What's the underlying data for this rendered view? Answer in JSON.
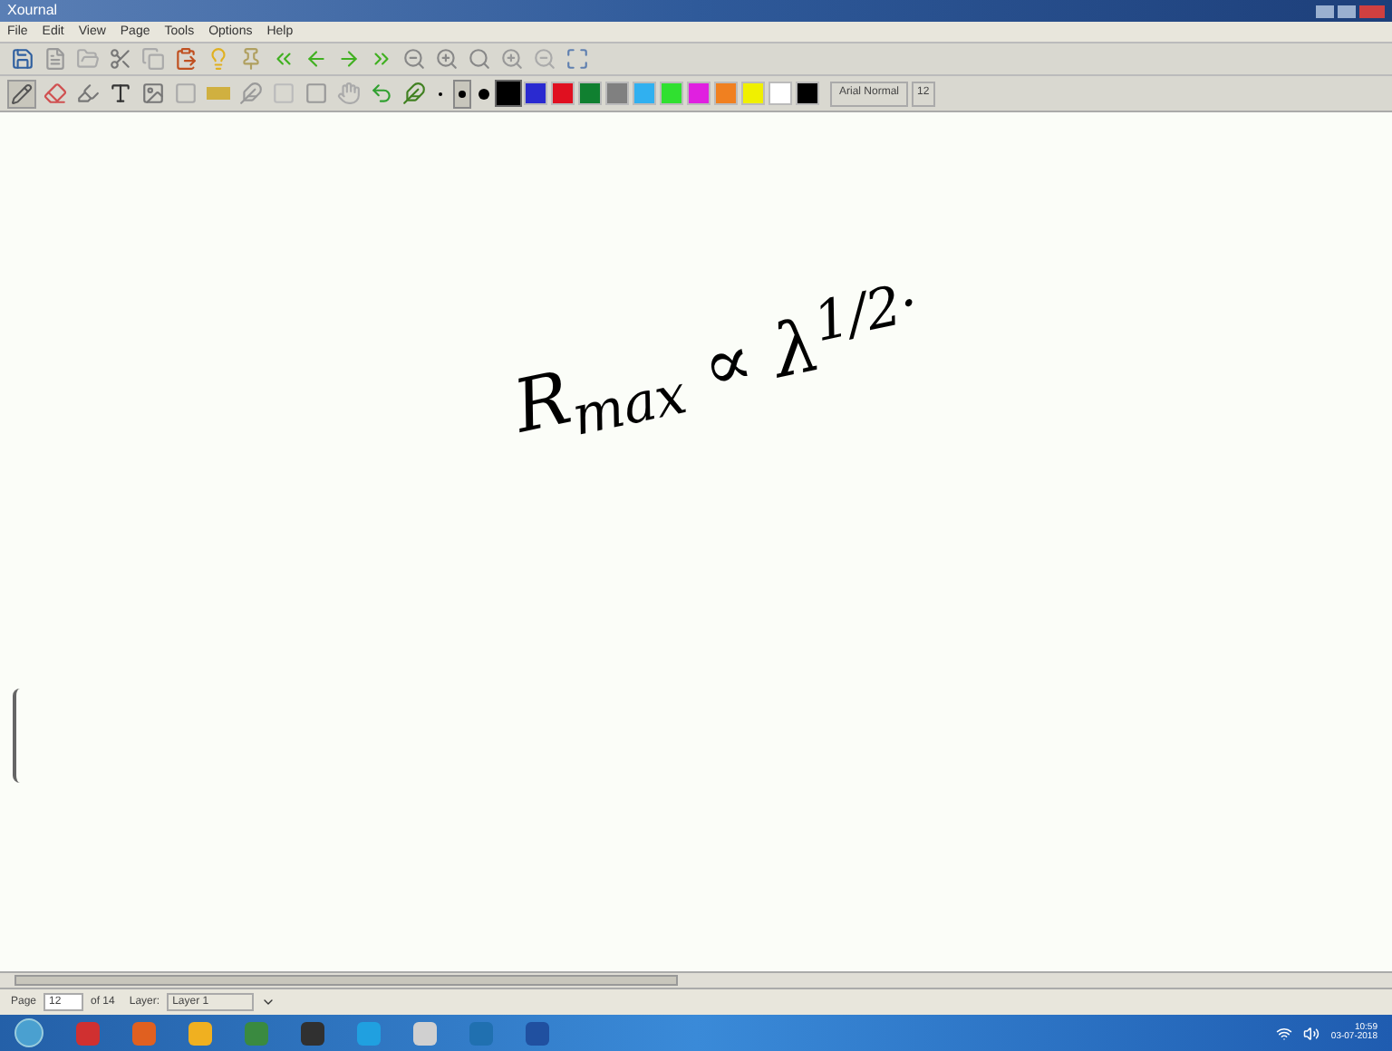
{
  "window": {
    "title": "Xournal"
  },
  "menu": [
    "File",
    "Edit",
    "View",
    "Page",
    "Tools",
    "Options",
    "Help"
  ],
  "pen_widths": [
    {
      "selected": false
    },
    {
      "selected": true
    },
    {
      "selected": false
    }
  ],
  "colors": [
    {
      "color": "#000000",
      "selected": true
    },
    {
      "color": "#2a2ad0",
      "selected": false
    },
    {
      "color": "#e01020",
      "selected": false
    },
    {
      "color": "#108030",
      "selected": false
    },
    {
      "color": "#808080",
      "selected": false
    },
    {
      "color": "#30b0f0",
      "selected": false
    },
    {
      "color": "#30e030",
      "selected": false
    },
    {
      "color": "#e020e0",
      "selected": false
    },
    {
      "color": "#f08020",
      "selected": false
    },
    {
      "color": "#f0f000",
      "selected": false
    },
    {
      "color": "#ffffff",
      "selected": false
    },
    {
      "color": "#000000",
      "selected": false
    }
  ],
  "font": {
    "name": "Arial Normal",
    "size": "12"
  },
  "canvas": {
    "ink": "R$_{max}$ ∝ λ$^{1/2·}$"
  },
  "status_bar": {
    "page_label": "Page",
    "page": "12",
    "page_total": "of 14",
    "layer_label": "Layer:",
    "layer": "Layer 1"
  },
  "taskbar": {
    "time": "10:59",
    "date": "03-07-2018"
  }
}
